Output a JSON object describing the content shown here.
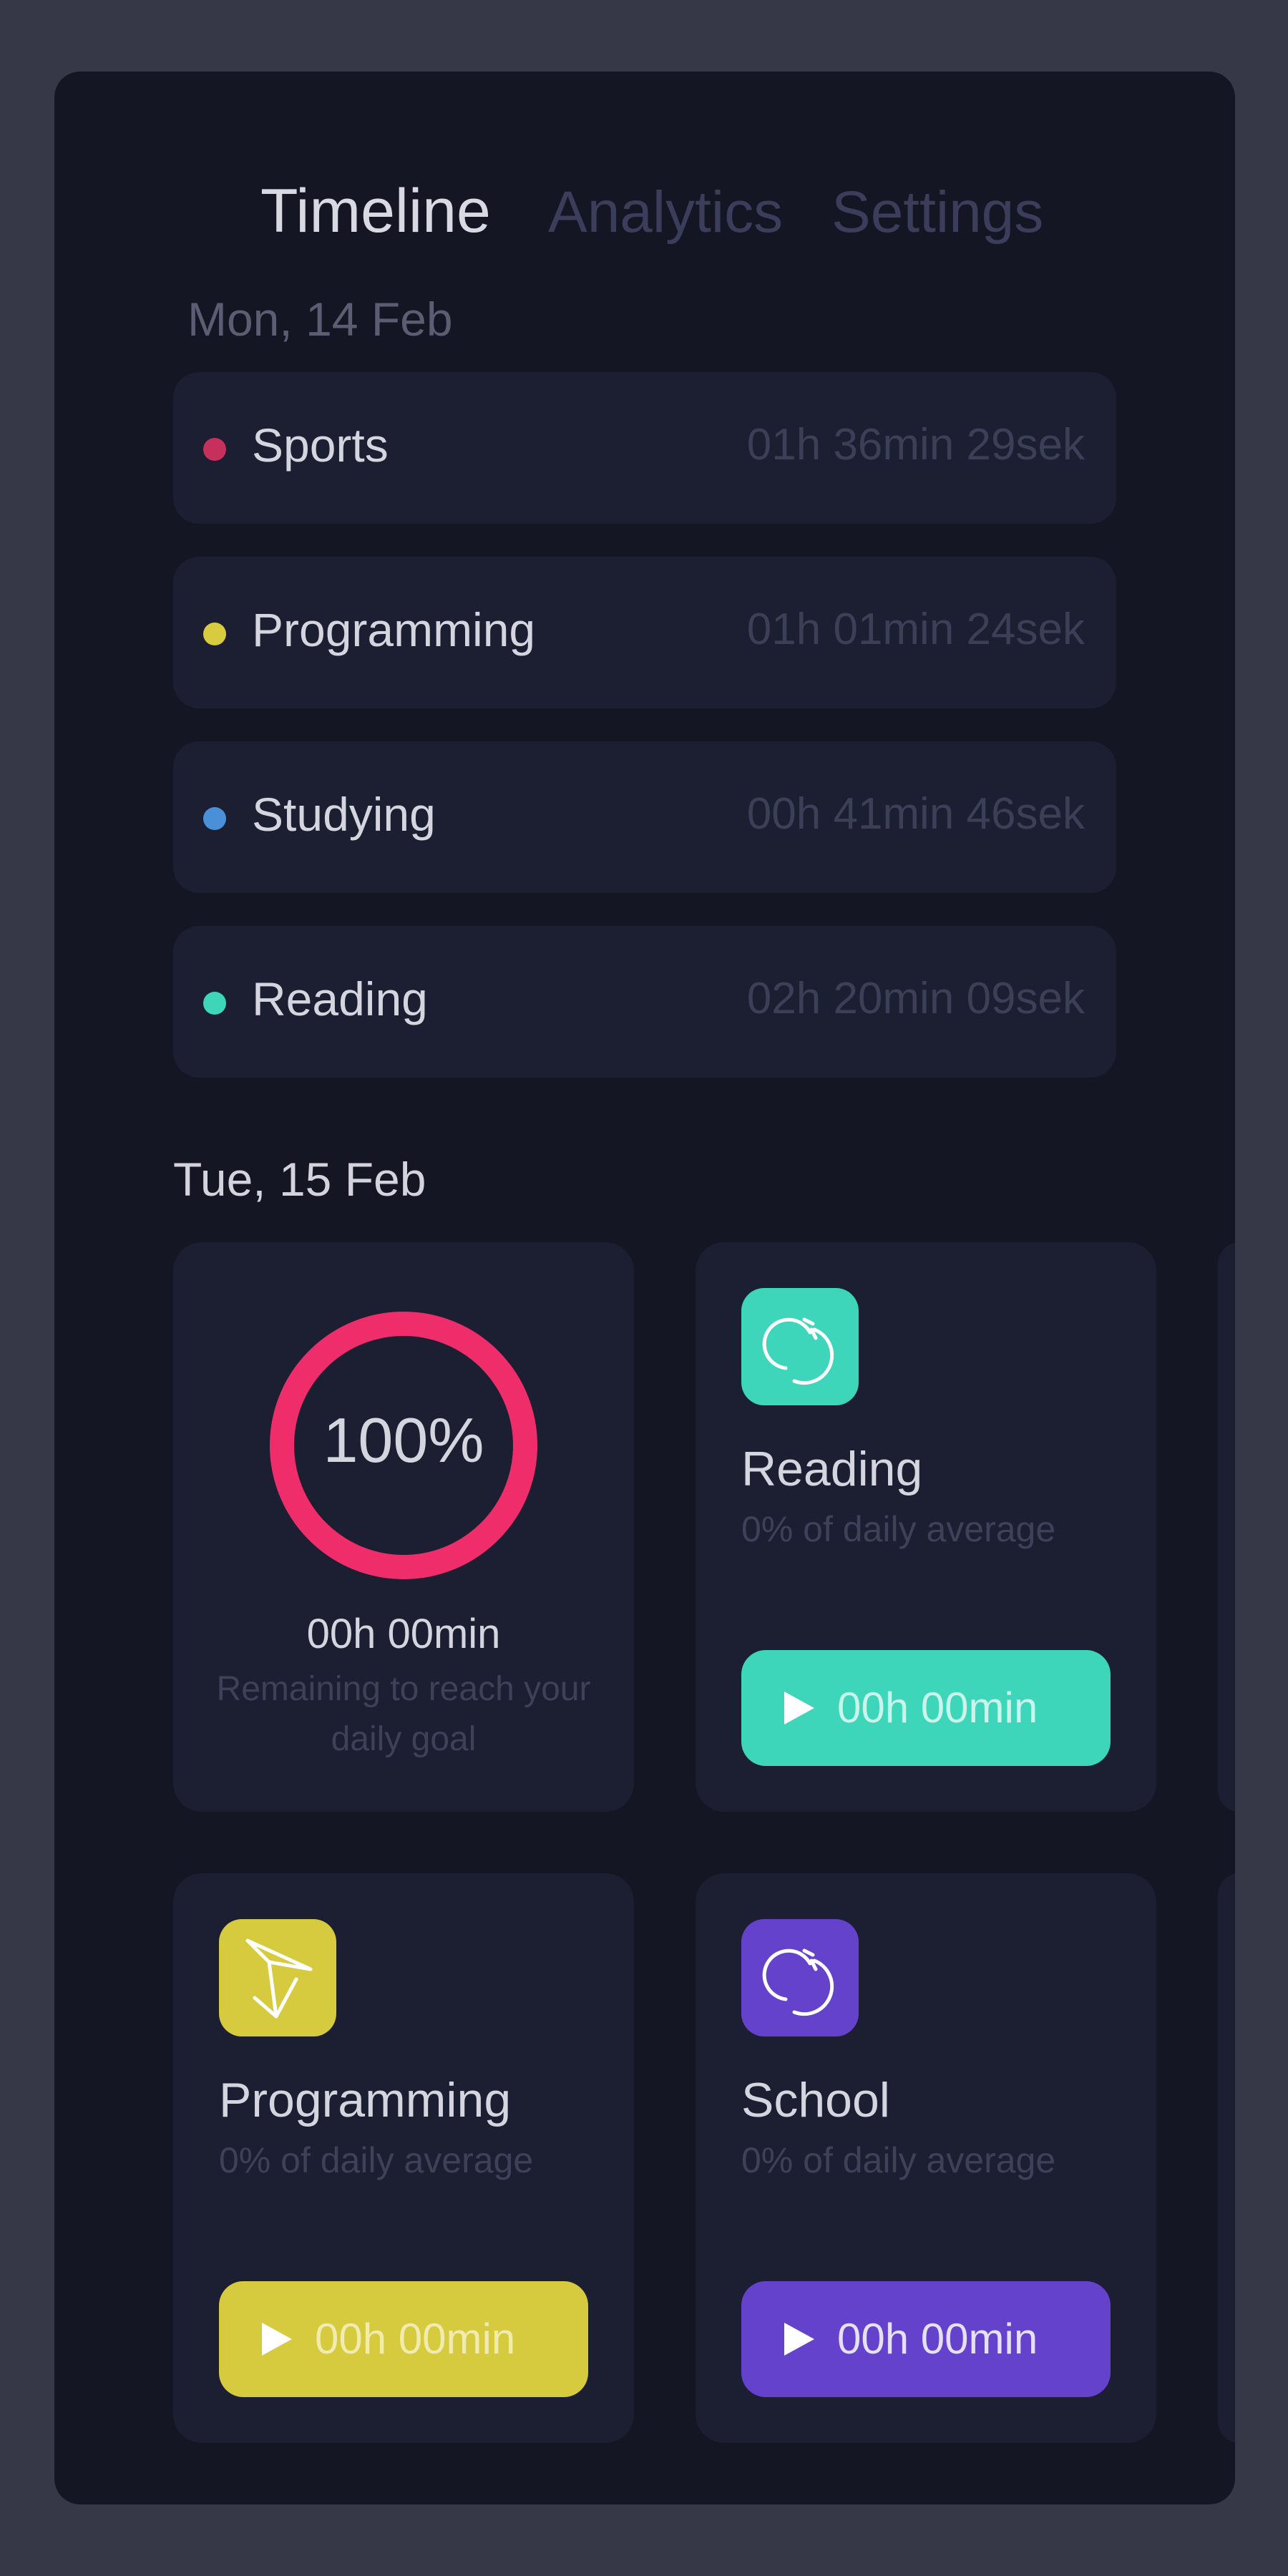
{
  "tabs": [
    {
      "label": "Timeline",
      "active": true
    },
    {
      "label": "Analytics",
      "active": false
    },
    {
      "label": "Settings",
      "active": false
    }
  ],
  "day1": {
    "date": "Mon, 14 Feb",
    "entries": [
      {
        "name": "Sports",
        "duration": "01h 36min 29sek",
        "color": "#c8305c"
      },
      {
        "name": "Programming",
        "duration": "01h 01min 24sek",
        "color": "#d9cb3f"
      },
      {
        "name": "Studying",
        "duration": "00h 41min 46sek",
        "color": "#4a90d9"
      },
      {
        "name": "Reading",
        "duration": "02h 20min 09sek",
        "color": "#3ed6b8"
      }
    ]
  },
  "day2": {
    "date": "Tue, 15 Feb",
    "goal": {
      "percent_label": "100%",
      "progress": 1.0,
      "ring_color": "#ef2d6b",
      "time": "00h 00min",
      "subtitle": "Remaining to reach your daily goal"
    },
    "activities": [
      {
        "title": "Reading",
        "subtitle": "0% of daily average",
        "button_time": "00h 00min",
        "color": "#3ed6bb",
        "icon": "refresh-circles-icon",
        "button_text_color": "#c9f5ea"
      },
      {
        "title": "Programming",
        "subtitle": "0% of daily average",
        "button_time": "00h 00min",
        "color": "#d6cb3e",
        "icon": "compass-icon",
        "button_text_color": "#f1ebb0"
      },
      {
        "title": "School",
        "subtitle": "0% of daily average",
        "button_time": "00h 00min",
        "color": "#6542cc",
        "icon": "refresh-circles-icon",
        "button_text_color": "#e6e0f7"
      }
    ]
  }
}
